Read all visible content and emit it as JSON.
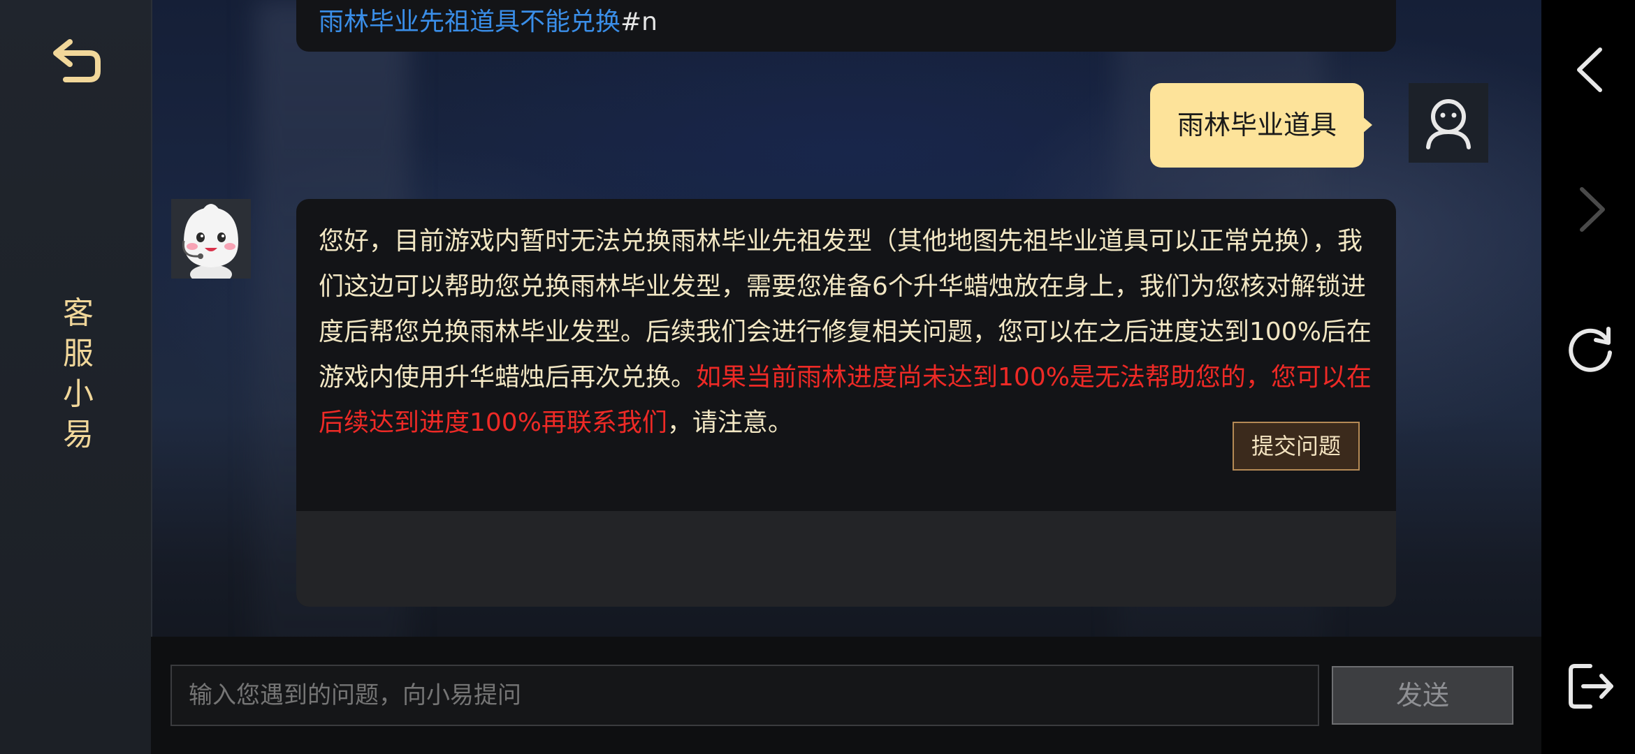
{
  "sidebar": {
    "title": "客服小易",
    "back_icon": "return-arrow-icon"
  },
  "chat": {
    "previous_message": {
      "link_text": "雨林毕业先祖道具不能兑换",
      "suffix": "#n"
    },
    "user_message": "雨林毕业道具",
    "bot_reply": {
      "normal": "您好，目前游戏内暂时无法兑换雨林毕业先祖发型（其他地图先祖毕业道具可以正常兑换），我们这边可以帮助您兑换雨林毕业发型，需要您准备6个升华蜡烛放在身上，我们为您核对解锁进度后帮您兑换雨林毕业发型。后续我们会进行修复相关问题，您可以在之后进度达到100%后在游戏内使用升华蜡烛后再次兑换。",
      "warning": "如果当前雨林进度尚未达到100%是无法帮助您的，您可以在后续达到进度100%再联系我们",
      "ending": "，请注意。"
    },
    "submit_label": "提交问题"
  },
  "input": {
    "placeholder": "输入您遇到的问题，向小易提问",
    "send_label": "发送"
  },
  "nav": {
    "icons": [
      "back-chevron-icon",
      "forward-chevron-icon",
      "refresh-icon",
      "exit-icon"
    ]
  },
  "colors": {
    "accent_gold": "#f1d79a",
    "user_bubble": "#fde39a",
    "link_blue": "#3a8ee8",
    "warning_red": "#ee2a26"
  }
}
